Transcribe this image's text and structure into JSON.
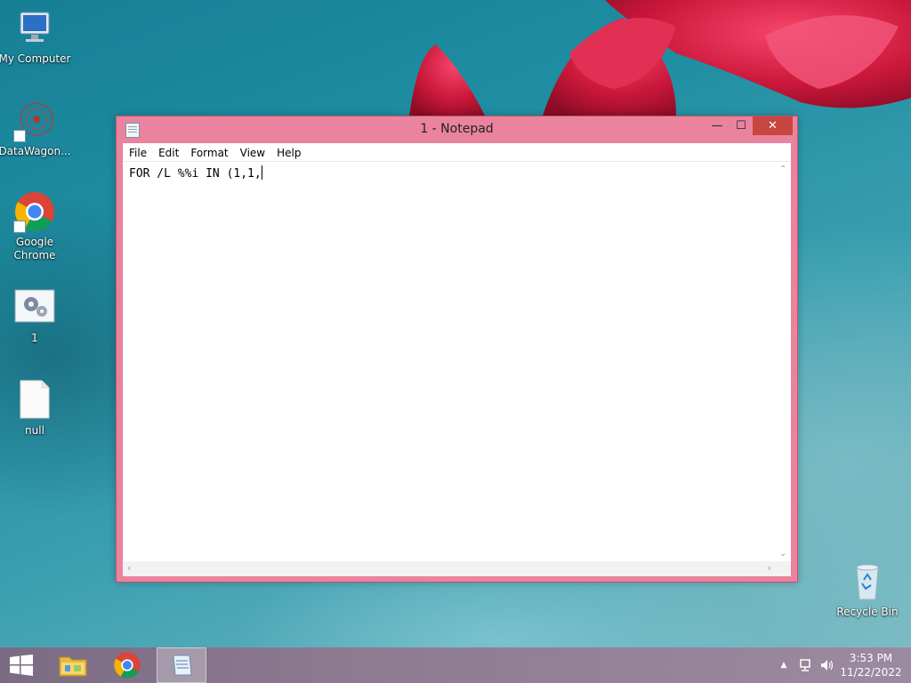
{
  "desktop": {
    "icons": [
      {
        "label": "My Computer",
        "icon": "computer-icon"
      },
      {
        "label": "DataWagon...",
        "icon": "datawagon-icon"
      },
      {
        "label": "Google Chrome",
        "icon": "chrome-icon"
      },
      {
        "label": "1",
        "icon": "batch-file-icon"
      },
      {
        "label": "null",
        "icon": "blank-file-icon"
      },
      {
        "label": "Recycle Bin",
        "icon": "recycle-bin-icon"
      }
    ]
  },
  "window": {
    "title": "1 - Notepad",
    "controls": {
      "minimize": "—",
      "maximize": "☐",
      "close": "✕"
    },
    "menu": [
      "File",
      "Edit",
      "Format",
      "View",
      "Help"
    ],
    "content": "FOR /L %%i IN (1,1,"
  },
  "taskbar": {
    "items": [
      "start-button",
      "file-explorer",
      "google-chrome",
      "notepad"
    ],
    "tray": {
      "show_hidden": "▲"
    },
    "clock": {
      "time": "3:53 PM",
      "date": "11/22/2022"
    }
  },
  "colors": {
    "window_frame": "#e9839e",
    "close_button": "#c7463f",
    "desktop": "#1f8ea2",
    "taskbar": "#8e7b92"
  }
}
